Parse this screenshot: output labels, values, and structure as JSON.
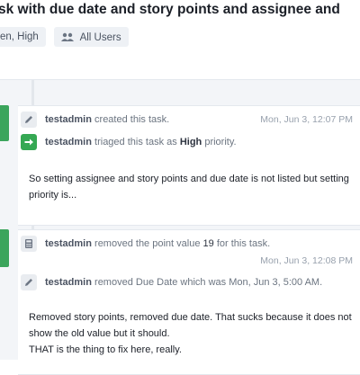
{
  "header": {
    "title": "sk with due date and story points and assignee and",
    "status_tag": "en, High",
    "users_tag": "All Users",
    "users_icon": "users-icon"
  },
  "timeline": {
    "accent_color": "#3ba55c",
    "group1": {
      "created": {
        "icon": "pencil-icon",
        "user": "testadmin",
        "action": "created this task.",
        "time": "Mon, Jun 3, 12:07 PM"
      },
      "triaged": {
        "icon": "arrow-right-icon",
        "user": "testadmin",
        "action_pre": "triaged this task as",
        "priority": "High",
        "action_post": "priority."
      },
      "comment_line1": "So setting assignee and story points and due date is not listed but setting",
      "comment_line2": "priority is..."
    },
    "group2": {
      "points": {
        "icon": "calculator-icon",
        "user": "testadmin",
        "action_pre": "removed the point value",
        "value": "19",
        "action_post": "for this task.",
        "time": "Mon, Jun 3, 12:08 PM"
      },
      "duedate": {
        "icon": "pencil-icon",
        "user": "testadmin",
        "action": "removed Due Date which was Mon, Jun 3, 5:00 AM."
      },
      "comment_line1": "Removed story points, removed due date. That sucks because it does not",
      "comment_line2": "show the old value but it should.",
      "comment_line3": "THAT is the thing to fix here, really."
    }
  }
}
